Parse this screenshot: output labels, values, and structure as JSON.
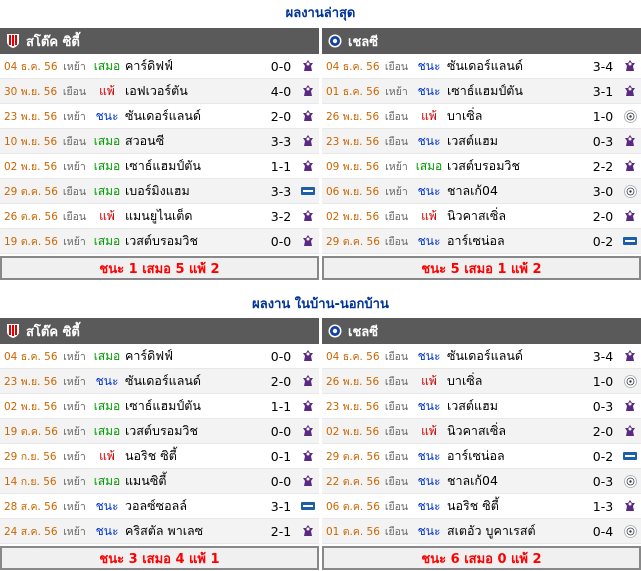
{
  "sections": [
    {
      "title": "ผลงานล่าสุด",
      "panels": [
        {
          "team": "สโต๊ค ซิตี้",
          "team_icon": "stoke-crest-icon",
          "rows": [
            {
              "date": "04 ธ.ค. 56",
              "venue": "เหย้า",
              "result": "เสมอ",
              "rtype": "draw",
              "opponent": "คาร์ดิฟฟ์",
              "score": "0-0",
              "comp": "pl"
            },
            {
              "date": "30 พ.ย. 56",
              "venue": "เยือน",
              "result": "แพ้",
              "rtype": "lose",
              "opponent": "เอฟเวอร์ตัน",
              "score": "4-0",
              "comp": "pl"
            },
            {
              "date": "23 พ.ย. 56",
              "venue": "เหย้า",
              "result": "ชนะ",
              "rtype": "win",
              "opponent": "ซันเดอร์แลนด์",
              "score": "2-0",
              "comp": "pl"
            },
            {
              "date": "10 พ.ย. 56",
              "venue": "เยือน",
              "result": "เสมอ",
              "rtype": "draw",
              "opponent": "สวอนซี",
              "score": "3-3",
              "comp": "pl"
            },
            {
              "date": "02 พ.ย. 56",
              "venue": "เหย้า",
              "result": "เสมอ",
              "rtype": "draw",
              "opponent": "เซาธ์แฮมป์ตัน",
              "score": "1-1",
              "comp": "pl"
            },
            {
              "date": "29 ต.ค. 56",
              "venue": "เยือน",
              "result": "เสมอ",
              "rtype": "draw",
              "opponent": "เบอร์มิงแฮม",
              "score": "3-3",
              "comp": "lc"
            },
            {
              "date": "26 ต.ค. 56",
              "venue": "เยือน",
              "result": "แพ้",
              "rtype": "lose",
              "opponent": "แมนยูไนเต็ด",
              "score": "3-2",
              "comp": "pl"
            },
            {
              "date": "19 ต.ค. 56",
              "venue": "เหย้า",
              "result": "เสมอ",
              "rtype": "draw",
              "opponent": "เวสต์บรอมวิช",
              "score": "0-0",
              "comp": "pl"
            }
          ],
          "summary": "ชนะ 1 เสมอ 5 แพ้ 2"
        },
        {
          "team": "เชลซี",
          "team_icon": "chelsea-crest-icon",
          "rows": [
            {
              "date": "04 ธ.ค. 56",
              "venue": "เยือน",
              "result": "ชนะ",
              "rtype": "win",
              "opponent": "ซันเดอร์แลนด์",
              "score": "3-4",
              "comp": "pl"
            },
            {
              "date": "01 ธ.ค. 56",
              "venue": "เหย้า",
              "result": "ชนะ",
              "rtype": "win",
              "opponent": "เซาธ์แฮมป์ตัน",
              "score": "3-1",
              "comp": "pl"
            },
            {
              "date": "26 พ.ย. 56",
              "venue": "เยือน",
              "result": "แพ้",
              "rtype": "lose",
              "opponent": "บาเซิ่ล",
              "score": "1-0",
              "comp": "ucl"
            },
            {
              "date": "23 พ.ย. 56",
              "venue": "เยือน",
              "result": "ชนะ",
              "rtype": "win",
              "opponent": "เวสต์แฮม",
              "score": "0-3",
              "comp": "pl"
            },
            {
              "date": "09 พ.ย. 56",
              "venue": "เหย้า",
              "result": "เสมอ",
              "rtype": "draw",
              "opponent": "เวสต์บรอมวิช",
              "score": "2-2",
              "comp": "pl"
            },
            {
              "date": "06 พ.ย. 56",
              "venue": "เหย้า",
              "result": "ชนะ",
              "rtype": "win",
              "opponent": "ชาลเก้04",
              "score": "3-0",
              "comp": "ucl"
            },
            {
              "date": "02 พ.ย. 56",
              "venue": "เยือน",
              "result": "แพ้",
              "rtype": "lose",
              "opponent": "นิวคาสเซิ่ล",
              "score": "2-0",
              "comp": "pl"
            },
            {
              "date": "29 ต.ค. 56",
              "venue": "เยือน",
              "result": "ชนะ",
              "rtype": "win",
              "opponent": "อาร์เซน่อล",
              "score": "0-2",
              "comp": "lc"
            }
          ],
          "summary": "ชนะ 5 เสมอ 1 แพ้ 2"
        }
      ]
    },
    {
      "title": "ผลงาน ในบ้าน-นอกบ้าน",
      "panels": [
        {
          "team": "สโต๊ค ซิตี้",
          "team_icon": "stoke-crest-icon",
          "rows": [
            {
              "date": "04 ธ.ค. 56",
              "venue": "เหย้า",
              "result": "เสมอ",
              "rtype": "draw",
              "opponent": "คาร์ดิฟฟ์",
              "score": "0-0",
              "comp": "pl"
            },
            {
              "date": "23 พ.ย. 56",
              "venue": "เหย้า",
              "result": "ชนะ",
              "rtype": "win",
              "opponent": "ซันเดอร์แลนด์",
              "score": "2-0",
              "comp": "pl"
            },
            {
              "date": "02 พ.ย. 56",
              "venue": "เหย้า",
              "result": "เสมอ",
              "rtype": "draw",
              "opponent": "เซาธ์แฮมป์ตัน",
              "score": "1-1",
              "comp": "pl"
            },
            {
              "date": "19 ต.ค. 56",
              "venue": "เหย้า",
              "result": "เสมอ",
              "rtype": "draw",
              "opponent": "เวสต์บรอมวิช",
              "score": "0-0",
              "comp": "pl"
            },
            {
              "date": "29 ก.ย. 56",
              "venue": "เหย้า",
              "result": "แพ้",
              "rtype": "lose",
              "opponent": "นอริช ซิตี้",
              "score": "0-1",
              "comp": "pl"
            },
            {
              "date": "14 ก.ย. 56",
              "venue": "เหย้า",
              "result": "เสมอ",
              "rtype": "draw",
              "opponent": "แมนซิตี้",
              "score": "0-0",
              "comp": "pl"
            },
            {
              "date": "28 ส.ค. 56",
              "venue": "เหย้า",
              "result": "ชนะ",
              "rtype": "win",
              "opponent": "วอลซ์ซอลล์",
              "score": "3-1",
              "comp": "lc"
            },
            {
              "date": "24 ส.ค. 56",
              "venue": "เหย้า",
              "result": "ชนะ",
              "rtype": "win",
              "opponent": "คริสตัล พาเลซ",
              "score": "2-1",
              "comp": "pl"
            }
          ],
          "summary": "ชนะ 3 เสมอ 4 แพ้ 1"
        },
        {
          "team": "เชลซี",
          "team_icon": "chelsea-crest-icon",
          "rows": [
            {
              "date": "04 ธ.ค. 56",
              "venue": "เยือน",
              "result": "ชนะ",
              "rtype": "win",
              "opponent": "ซันเดอร์แลนด์",
              "score": "3-4",
              "comp": "pl"
            },
            {
              "date": "26 พ.ย. 56",
              "venue": "เยือน",
              "result": "แพ้",
              "rtype": "lose",
              "opponent": "บาเซิ่ล",
              "score": "1-0",
              "comp": "ucl"
            },
            {
              "date": "23 พ.ย. 56",
              "venue": "เยือน",
              "result": "ชนะ",
              "rtype": "win",
              "opponent": "เวสต์แฮม",
              "score": "0-3",
              "comp": "pl"
            },
            {
              "date": "02 พ.ย. 56",
              "venue": "เยือน",
              "result": "แพ้",
              "rtype": "lose",
              "opponent": "นิวคาสเซิ่ล",
              "score": "2-0",
              "comp": "pl"
            },
            {
              "date": "29 ต.ค. 56",
              "venue": "เยือน",
              "result": "ชนะ",
              "rtype": "win",
              "opponent": "อาร์เซน่อล",
              "score": "0-2",
              "comp": "lc"
            },
            {
              "date": "22 ต.ค. 56",
              "venue": "เยือน",
              "result": "ชนะ",
              "rtype": "win",
              "opponent": "ชาลเก้04",
              "score": "0-3",
              "comp": "ucl"
            },
            {
              "date": "06 ต.ค. 56",
              "venue": "เยือน",
              "result": "ชนะ",
              "rtype": "win",
              "opponent": "นอริช ซิตี้",
              "score": "1-3",
              "comp": "pl"
            },
            {
              "date": "01 ต.ค. 56",
              "venue": "เยือน",
              "result": "ชนะ",
              "rtype": "win",
              "opponent": "สเตอัว บูคาเรสต์",
              "score": "0-4",
              "comp": "ucl"
            }
          ],
          "summary": "ชนะ 6 เสมอ 0 แพ้ 2"
        }
      ]
    }
  ],
  "colors": {
    "title": "#003399",
    "header_bg": "#5a5a5a",
    "date": "#cc6600",
    "win": "#0033cc",
    "draw": "#009900",
    "lose": "#cc0000",
    "summary": "#ff0000"
  }
}
